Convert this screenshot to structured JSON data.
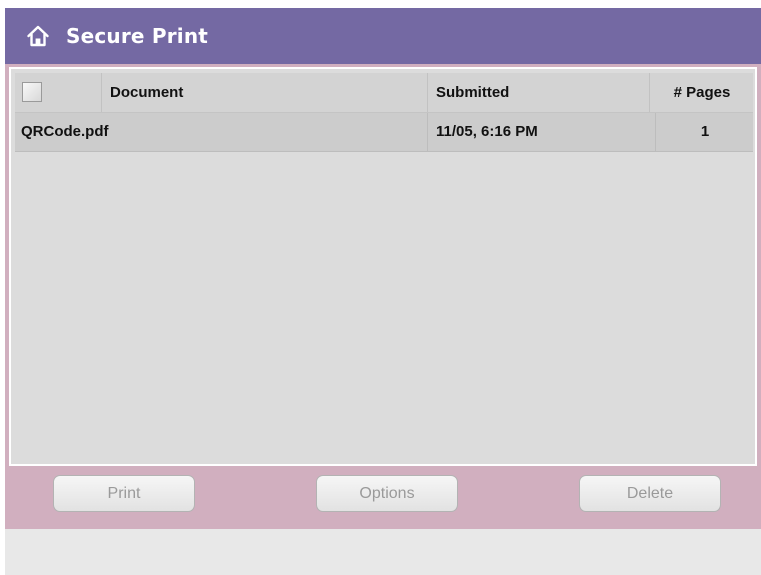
{
  "header": {
    "icon": "home-icon",
    "title": "Secure Print",
    "background_color": "#7469a3"
  },
  "table": {
    "columns": [
      "Document",
      "Submitted",
      "# Pages"
    ],
    "rows": [
      {
        "document": "QRCode.pdf",
        "submitted": "11/05, 6:16 PM",
        "pages": "1"
      }
    ]
  },
  "actions": {
    "print_label": "Print",
    "options_label": "Options",
    "delete_label": "Delete",
    "background_color": "#d1afbf"
  }
}
